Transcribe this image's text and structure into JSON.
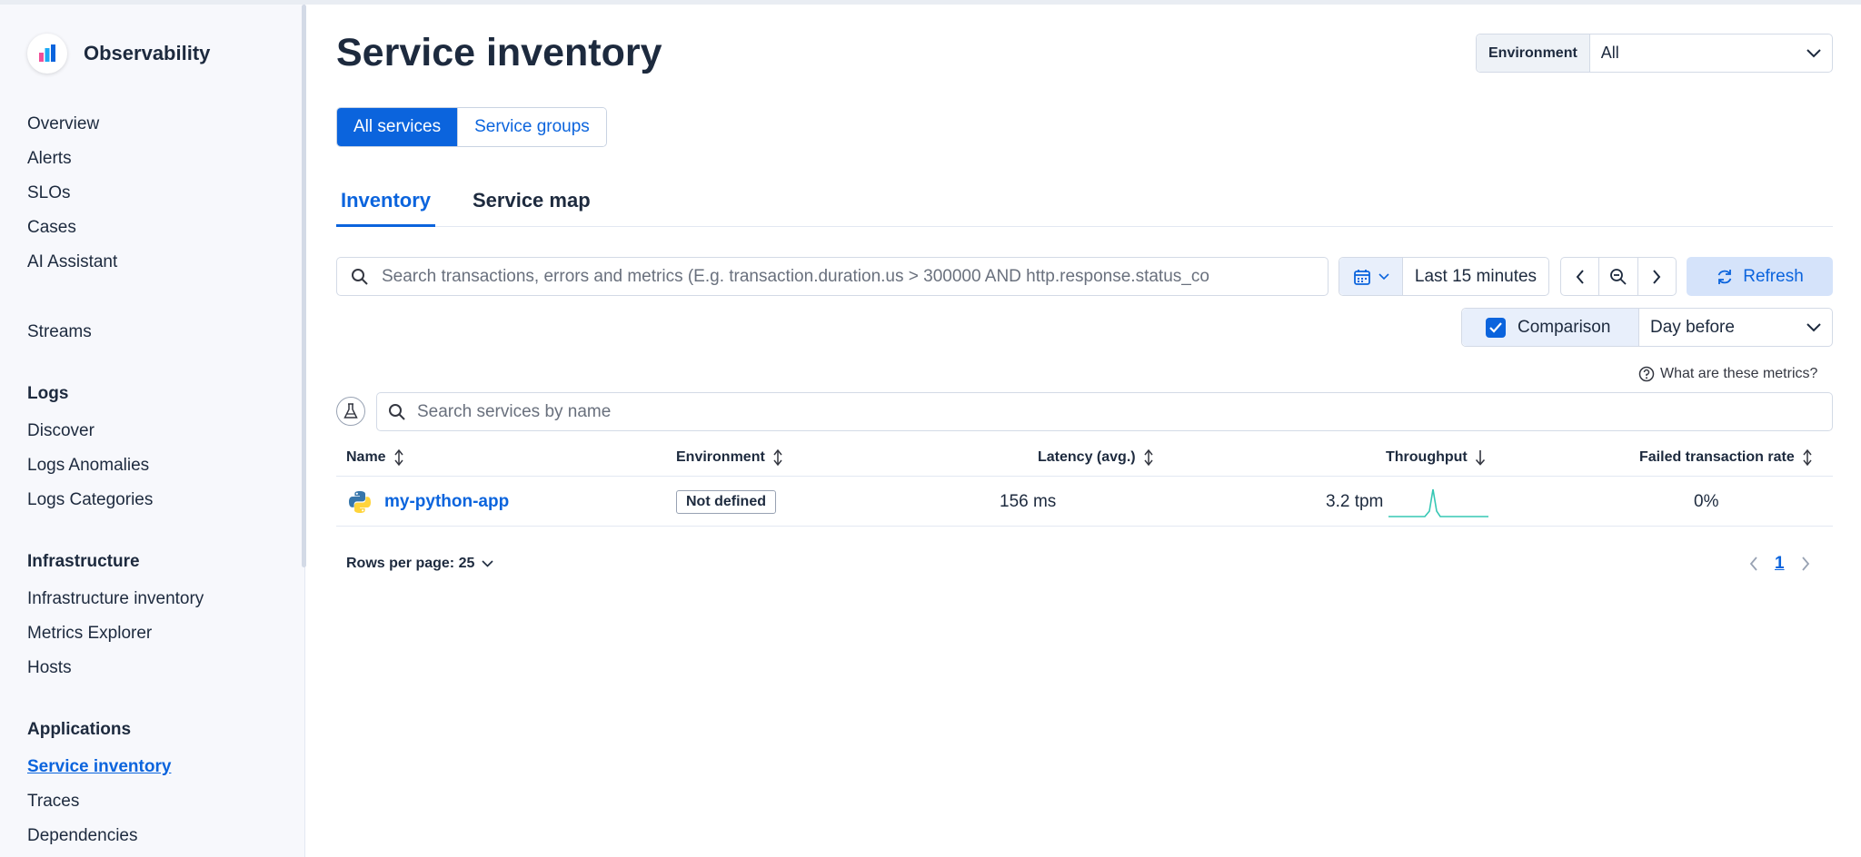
{
  "brand": {
    "title": "Observability"
  },
  "sidebar": {
    "items_top": [
      "Overview",
      "Alerts",
      "SLOs",
      "Cases",
      "AI Assistant"
    ],
    "streams": "Streams",
    "logs": {
      "heading": "Logs",
      "items": [
        "Discover",
        "Logs Anomalies",
        "Logs Categories"
      ]
    },
    "infrastructure": {
      "heading": "Infrastructure",
      "items": [
        "Infrastructure inventory",
        "Metrics Explorer",
        "Hosts"
      ]
    },
    "applications": {
      "heading": "Applications",
      "items": [
        "Service inventory",
        "Traces",
        "Dependencies"
      ]
    }
  },
  "page": {
    "title": "Service inventory"
  },
  "environment": {
    "label": "Environment",
    "value": "All"
  },
  "segments": {
    "all_services": "All services",
    "service_groups": "Service groups"
  },
  "tabs": {
    "inventory": "Inventory",
    "service_map": "Service map"
  },
  "query": {
    "placeholder": "Search transactions, errors and metrics (E.g. transaction.duration.us > 300000 AND http.response.status_co"
  },
  "date": {
    "range": "Last 15 minutes"
  },
  "refresh": {
    "label": "Refresh"
  },
  "comparison": {
    "label": "Comparison",
    "value": "Day before",
    "checked": true
  },
  "metrics_help": "What are these metrics?",
  "service_search": {
    "placeholder": "Search services by name"
  },
  "table": {
    "headers": {
      "name": "Name",
      "environment": "Environment",
      "latency": "Latency (avg.)",
      "throughput": "Throughput",
      "failed": "Failed transaction rate"
    },
    "rows": [
      {
        "name": "my-python-app",
        "environment": "Not defined",
        "latency": "156 ms",
        "throughput": "3.2 tpm",
        "failed": "0%"
      }
    ]
  },
  "pagination": {
    "rows_per_page": "Rows per page: 25",
    "current_page": "1"
  },
  "colors": {
    "primary": "#0b64dd",
    "sparkline": "#36c7b4",
    "text": "#1d2a3e"
  }
}
